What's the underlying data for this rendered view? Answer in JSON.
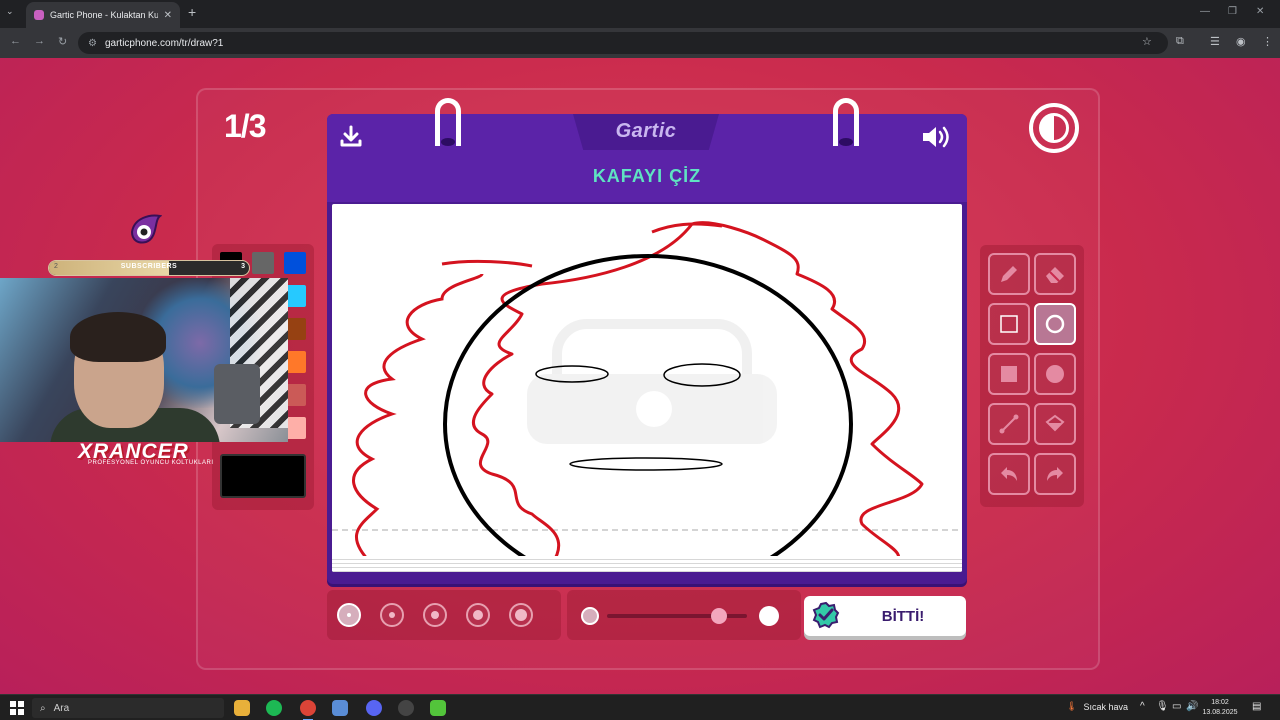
{
  "browser": {
    "tab_title": "Gartic Phone - Kulaktan Kulağa",
    "tab_close": "✕",
    "new_tab": "+",
    "url": "garticphone.com/tr/draw?1"
  },
  "game": {
    "round": "1/3",
    "logo": "Gartic",
    "prompt_title": "KAFAYI ÇİZ",
    "done_label": "BİTTİ!",
    "current_color": "#000000",
    "opacity_level": 0.8,
    "selected_brush_index": 0,
    "selected_tool": "ellipse-outline",
    "palette": [
      "#000000",
      "#666666",
      "#0050dc",
      "#ffffff",
      "#aaaaaa",
      "#26c9ff",
      "#017420",
      "#990000",
      "#964112",
      "#11b03c",
      "#ff0013",
      "#ff7829",
      "#b0701c",
      "#99004e",
      "#cb5a57",
      "#ffc126",
      "#ff008f",
      "#feafa8"
    ],
    "tools": [
      "pencil",
      "eraser",
      "rect-outline",
      "ellipse-outline",
      "rect-fill",
      "ellipse-fill",
      "line",
      "bucket",
      "undo",
      "redo"
    ],
    "brush_sizes": [
      1,
      2,
      3,
      4,
      5
    ]
  },
  "overlay": {
    "subscribers_label": "SUBSCRIBERS",
    "subscribers_start": "2",
    "subscribers_goal": "3",
    "brand": "XRANCER",
    "brand_sub": "PROFESYONEL OYUNCU KOLTUKLARI"
  },
  "taskbar": {
    "search_placeholder": "Ara",
    "weather": "Sıcak hava",
    "time": "18:02",
    "date": "13.08.2025"
  }
}
